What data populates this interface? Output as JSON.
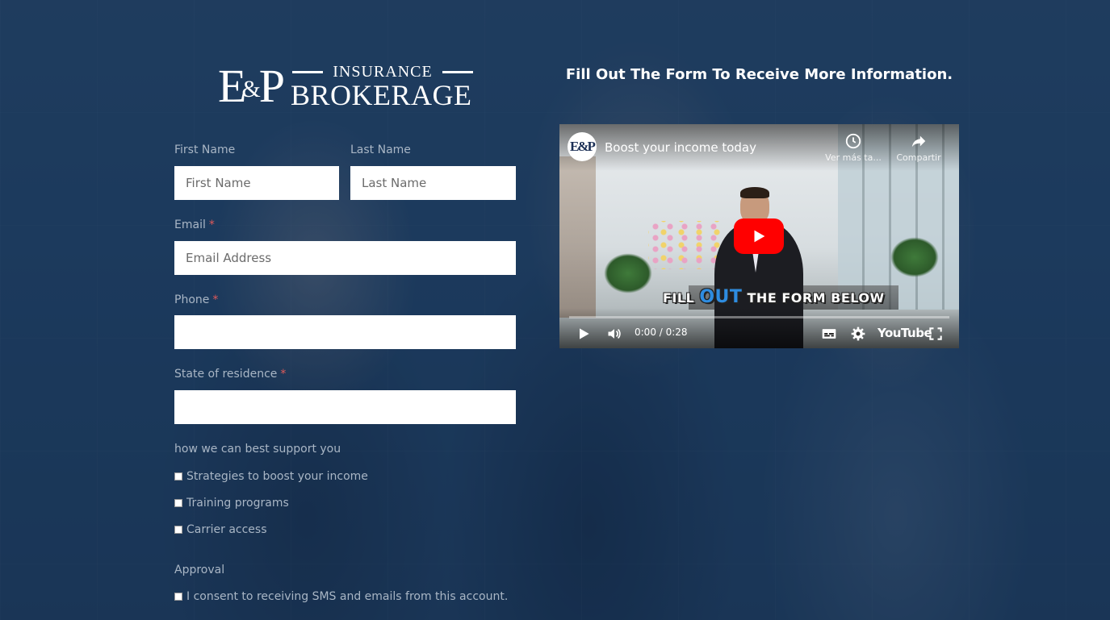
{
  "logo": {
    "monogram_e": "E",
    "monogram_amp": "&",
    "monogram_p": "P",
    "line1": "INSURANCE",
    "line2": "BROKERAGE"
  },
  "heading": "Fill Out The Form To Receive More Information.",
  "form": {
    "first_name": {
      "label": "First Name",
      "placeholder": "First Name",
      "value": ""
    },
    "last_name": {
      "label": "Last Name",
      "placeholder": "Last Name",
      "value": ""
    },
    "email": {
      "label": "Email",
      "required": "*",
      "placeholder": "Email Address",
      "value": ""
    },
    "phone": {
      "label": "Phone",
      "required": "*",
      "value": ""
    },
    "state": {
      "label": "State of residence",
      "required": "*",
      "value": ""
    },
    "support": {
      "label": "how we can best support you",
      "options": [
        {
          "label": "Strategies to boost your income",
          "checked": false
        },
        {
          "label": "Training programs",
          "checked": false
        },
        {
          "label": "Carrier access",
          "checked": false
        }
      ]
    },
    "approval": {
      "label": "Approval",
      "consent": {
        "label": "I consent to receiving SMS and emails from this account.",
        "checked": false
      }
    }
  },
  "video": {
    "channel_avatar": "E&P",
    "title": "Boost your income today",
    "watch_later_label": "Ver más ta...",
    "share_label": "Compartir",
    "caption_pre": "FILL",
    "caption_highlight": "OUT",
    "caption_post": "THE FORM BELOW",
    "time": "0:00 / 0:28",
    "youtube_label": "YouTube",
    "progress": 0
  },
  "colors": {
    "background": "#1e3857",
    "label": "#a9b6c5",
    "required": "#e05a5a",
    "play_button": "#ff0000"
  }
}
